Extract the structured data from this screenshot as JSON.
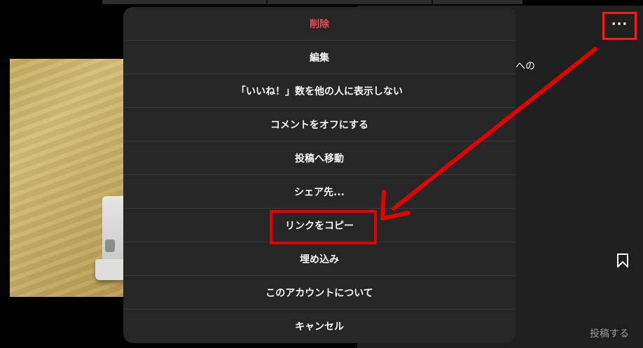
{
  "menu": {
    "items": [
      {
        "label": "削除"
      },
      {
        "label": "編集"
      },
      {
        "label": "「いいね！」数を他の人に表示しない"
      },
      {
        "label": "コメントをオフにする"
      },
      {
        "label": "投稿へ移動"
      },
      {
        "label": "シェア先..."
      },
      {
        "label": "リンクをコピー"
      },
      {
        "label": "埋め込み"
      },
      {
        "label": "このアカウントについて"
      },
      {
        "label": "キャンセル"
      }
    ]
  },
  "background": {
    "partial_text": "への",
    "more_button": "···",
    "post_label": "投稿する"
  },
  "colors": {
    "danger": "#ed4956",
    "annotation": "#e50000",
    "sheet": "#262626"
  },
  "icons": [
    "more-options-icon",
    "bookmark-icon",
    "arrow-annotation"
  ]
}
